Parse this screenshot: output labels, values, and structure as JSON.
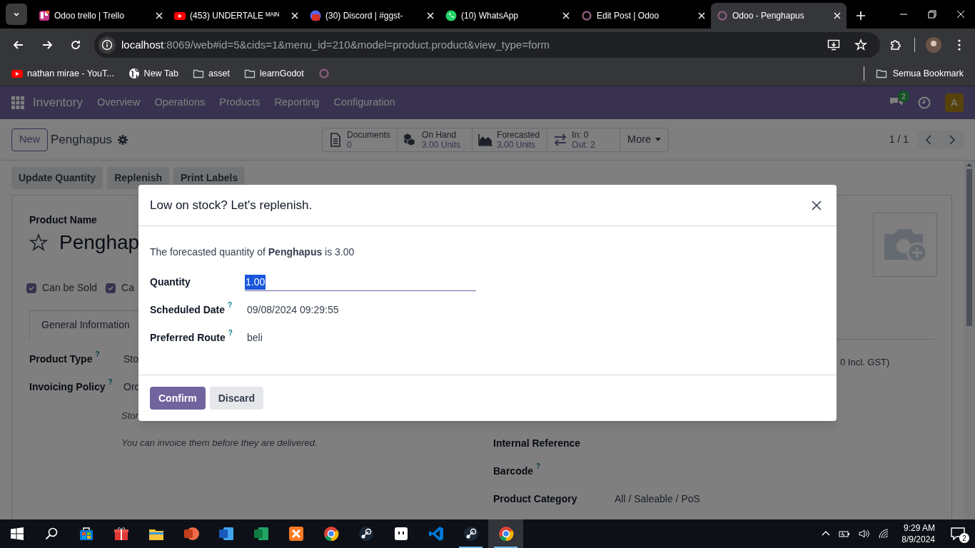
{
  "browser": {
    "tabs": [
      {
        "title": "Odoo trello | Trello",
        "kind": "trello",
        "selected": false
      },
      {
        "title": "(453) UNDERTALE ᴹᴬᴵᴺ",
        "kind": "youtube",
        "selected": false
      },
      {
        "title": "(30) Discord | #ggst-",
        "kind": "discord",
        "selected": false
      },
      {
        "title": "(10) WhatsApp",
        "kind": "whatsapp",
        "selected": false
      },
      {
        "title": "Edit Post | Odoo",
        "kind": "odoo",
        "selected": false
      },
      {
        "title": "Odoo - Penghapus",
        "kind": "odoo",
        "selected": true
      }
    ],
    "address": {
      "host": "localhost",
      "rest": ":8069/web#id=5&cids=1&menu_id=210&model=product.product&view_type=form"
    },
    "bookmarks": [
      {
        "label": "nathan mirae - YouT...",
        "kind": "youtube"
      },
      {
        "label": "New Tab",
        "kind": "globe"
      },
      {
        "label": "asset",
        "kind": "folder"
      },
      {
        "label": "learnGodot",
        "kind": "folder"
      },
      {
        "kind": "odoo"
      }
    ],
    "all_bookmarks": "Semua Bookmark"
  },
  "odoo": {
    "app": "Inventory",
    "menu": [
      "Overview",
      "Operations",
      "Products",
      "Reporting",
      "Configuration"
    ],
    "message_count": "2",
    "avatar": "A",
    "new_button": "New",
    "record": "Penghapus",
    "smart_buttons": [
      {
        "kind": "documents",
        "lines": [
          "Documents",
          "0"
        ]
      },
      {
        "kind": "onhand",
        "lines": [
          "On Hand",
          "3.00 Units"
        ]
      },
      {
        "kind": "forecast",
        "lines": [
          "Forecasted",
          "3.00 Units"
        ]
      },
      {
        "kind": "inout",
        "lines": [
          "In: 0",
          "Out: 2"
        ]
      }
    ],
    "more": "More",
    "pager": "1 / 1",
    "actions": [
      "Update Quantity",
      "Replenish",
      "Print Labels"
    ],
    "form": {
      "name_label": "Product Name",
      "name": "Penghap",
      "favorite": false,
      "checkboxes": [
        {
          "label": "Can be Sold",
          "checked": true
        },
        {
          "label": "Ca",
          "checked": true
        }
      ],
      "tabs": [
        {
          "label": "General Information",
          "selected": true
        }
      ],
      "fields": [
        {
          "label": "Product Type",
          "help": "?",
          "value": "Sto"
        },
        {
          "label": "Invoicing Policy",
          "help": "?",
          "value": "Orc"
        }
      ],
      "notes": [
        "Stor",
        "You can invoice them before they are delivered."
      ],
      "price_tail": "0 Incl. GST)",
      "right_fields": [
        {
          "label": "Internal Reference"
        },
        {
          "label": "Barcode",
          "help": "?"
        },
        {
          "label": "Product Category",
          "value": "All / Saleable / PoS"
        }
      ]
    }
  },
  "dialog": {
    "title": "Low on stock? Let's replenish.",
    "message": "The forecasted quantity of **Penghapus** is 3.00",
    "fields": [
      {
        "kind": "input",
        "label": "Quantity",
        "value": "1.00"
      },
      {
        "kind": "text",
        "label": "Scheduled Date",
        "help": "?",
        "value": "09/08/2024 09:29:55"
      },
      {
        "kind": "text",
        "label": "Preferred Route",
        "help": "?",
        "value": "beli"
      }
    ],
    "buttons": [
      {
        "label": "Confirm",
        "kind": "primary"
      },
      {
        "label": "Discard",
        "kind": "secondary"
      }
    ]
  },
  "taskbar": {
    "apps": [
      {
        "kind": "store",
        "open": false
      },
      {
        "kind": "gift",
        "open": false
      },
      {
        "kind": "explorer",
        "open": false
      },
      {
        "kind": "powerpoint",
        "open": false
      },
      {
        "kind": "word",
        "open": false
      },
      {
        "kind": "excel",
        "open": false
      },
      {
        "kind": "xampp",
        "open": false
      },
      {
        "kind": "chrome",
        "open": false
      },
      {
        "kind": "steam",
        "open": false
      },
      {
        "kind": "box",
        "open": false
      },
      {
        "kind": "vscode",
        "open": false
      },
      {
        "kind": "steam",
        "open": true
      },
      {
        "kind": "chrome",
        "open": true
      }
    ],
    "time": "9:29 AM",
    "date": "8/9/2024",
    "notifications": "2"
  }
}
